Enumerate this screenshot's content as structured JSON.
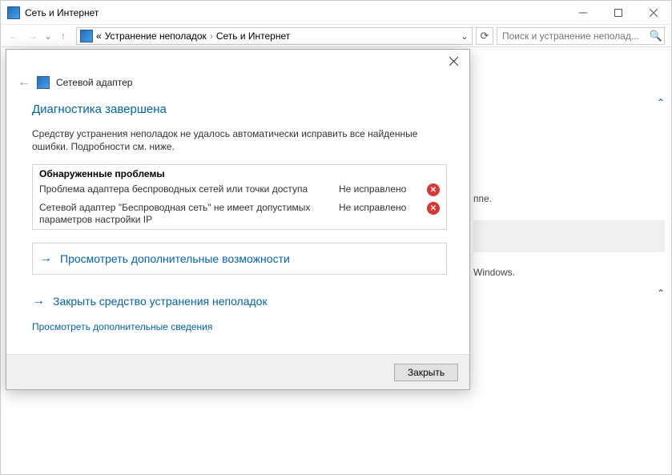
{
  "window": {
    "title": "Сеть и Интернет"
  },
  "nav": {
    "address": {
      "chevrons": "«",
      "seg1": "Устранение неполадок",
      "seg2": "Сеть и Интернет"
    },
    "search_placeholder": "Поиск и устранение неполад..."
  },
  "behind": {
    "frag1": "ппе.",
    "frag2": "Windows."
  },
  "dialog": {
    "app_name": "Сетевой адаптер",
    "heading": "Диагностика завершена",
    "desc": "Средству устранения неполадок не удалось автоматически исправить все найденные ошибки. Подробности см. ниже.",
    "panel_title": "Обнаруженные проблемы",
    "rows": [
      {
        "text": "Проблема адаптера беспроводных сетей или точки доступа",
        "status": "Не исправлено"
      },
      {
        "text": "Сетевой адаптер \"Беспроводная сеть\" не имеет допустимых параметров настройки IP",
        "status": "Не исправлено"
      }
    ],
    "action_more": "Просмотреть дополнительные возможности",
    "action_close_troubleshooter": "Закрыть средство устранения неполадок",
    "link_more_info": "Просмотреть дополнительные сведения",
    "close_button": "Закрыть"
  }
}
